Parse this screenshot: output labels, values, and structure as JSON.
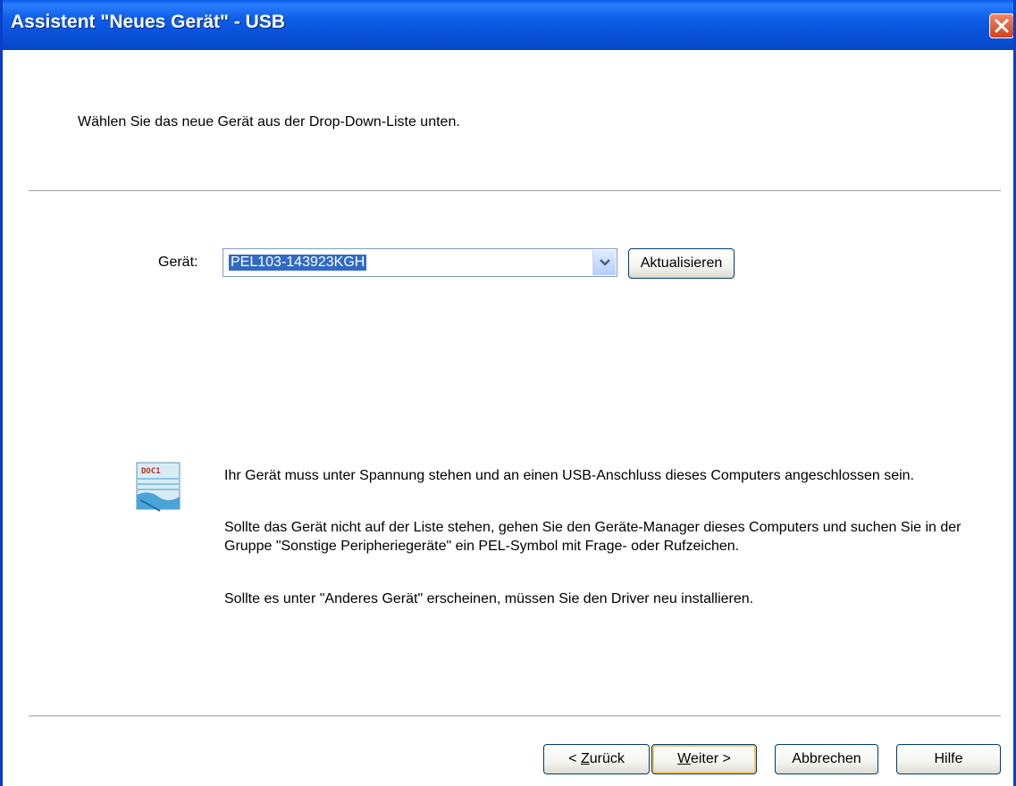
{
  "window": {
    "title": "Assistent \"Neues Gerät\" - USB"
  },
  "header": {
    "instruction": "Wählen Sie das neue Gerät aus der Drop-Down-Liste unten."
  },
  "device": {
    "label": "Gerät:",
    "selected_value": "PEL103-143923KGH",
    "refresh_label": "Aktualisieren"
  },
  "info": {
    "line1": "Ihr Gerät muss unter Spannung stehen und an einen USB-Anschluss dieses Computers angeschlossen sein.",
    "line2": "Sollte das Gerät nicht auf der Liste stehen, gehen Sie den Geräte-Manager dieses Computers und suchen Sie in der Gruppe \"Sonstige Peripheriegeräte\" ein PEL-Symbol mit Frage- oder Rufzeichen.",
    "line3": "Sollte es unter \"Anderes Gerät\" erscheinen, müssen Sie den Driver neu installieren.",
    "icon_text": "DOC1"
  },
  "buttons": {
    "back_prefix": "< ",
    "back_mnemonic": "Z",
    "back_rest": "urück",
    "next_mnemonic": "W",
    "next_rest": "eiter >",
    "cancel": "Abbrechen",
    "help": "Hilfe"
  }
}
